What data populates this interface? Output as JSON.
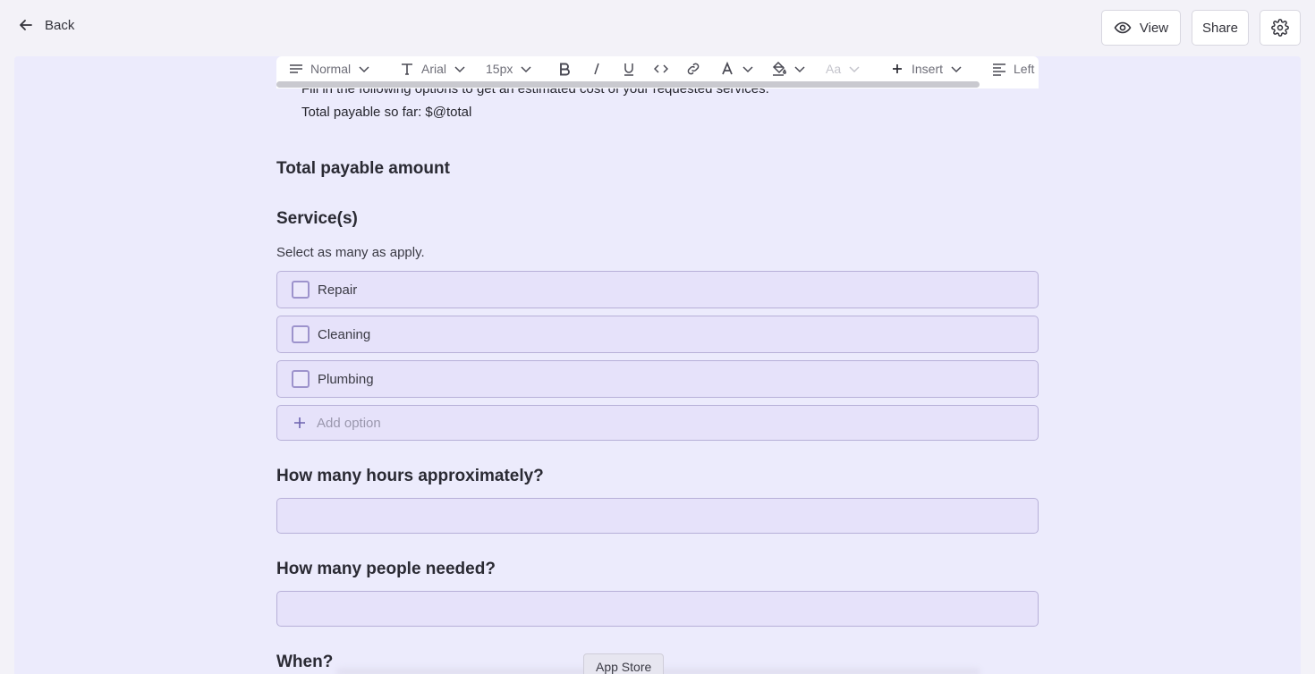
{
  "header": {
    "back_label": "Back",
    "view_label": "View",
    "share_label": "Share"
  },
  "toolbar": {
    "paragraph_style": "Normal",
    "font_family": "Arial",
    "font_size": "15px",
    "case_label": "Aa",
    "insert_label": "Insert",
    "align_label": "Left"
  },
  "form": {
    "intro_line1": "Fill in the following options to get an estimated cost of your requested services.",
    "intro_line2": "Total payable so far: $@total",
    "total_heading": "Total payable amount",
    "services_heading": "Service(s)",
    "services_hint": "Select as many as apply.",
    "options": [
      {
        "label": "Repair",
        "checked": false
      },
      {
        "label": "Cleaning",
        "checked": false
      },
      {
        "label": "Plumbing",
        "checked": false
      }
    ],
    "add_option_label": "Add option",
    "hours_heading": "How many hours approximately?",
    "hours_value": "",
    "people_heading": "How many people needed?",
    "people_value": "",
    "when_heading": "When?"
  },
  "tooltip": {
    "label": "App Store"
  },
  "colors": {
    "canvas_bg": "#ecebfc",
    "option_bg": "#e6e2fa",
    "option_border": "#b7b0d8",
    "checkbox_border": "#9d93cc"
  }
}
